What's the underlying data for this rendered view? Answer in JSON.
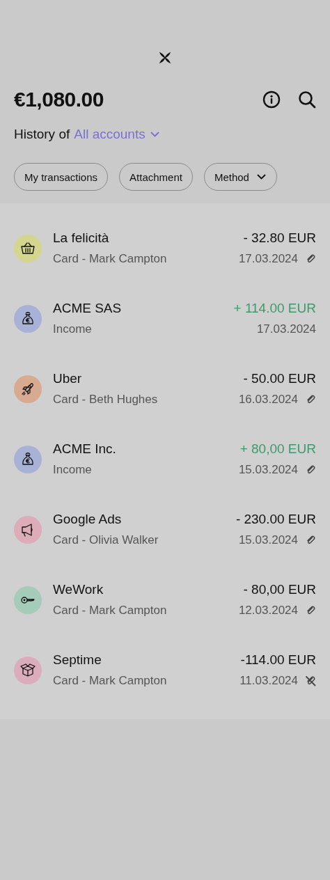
{
  "balance": "€1,080.00",
  "history": {
    "label": "History of",
    "account": "All accounts"
  },
  "filters": [
    {
      "label": "My transactions",
      "dropdown": false
    },
    {
      "label": "Attachment",
      "dropdown": false
    },
    {
      "label": "Method",
      "dropdown": true
    }
  ],
  "transactions": [
    {
      "name": "La felicità",
      "detail": "Card - Mark Campton",
      "amount": "- 32.80 EUR",
      "date": "17.03.2024",
      "credit": false,
      "clip": true,
      "attached": true,
      "kind": "basket",
      "color": "#d5d68e"
    },
    {
      "name": "ACME SAS",
      "detail": "Income",
      "amount": "+ 114.00 EUR",
      "date": "17.03.2024",
      "credit": true,
      "clip": false,
      "kind": "moneybag",
      "color": "#a8b2d6"
    },
    {
      "name": "Uber",
      "detail": "Card - Beth Hughes",
      "amount": "- 50.00 EUR",
      "date": "16.03.2024",
      "credit": false,
      "clip": true,
      "attached": true,
      "kind": "rocket",
      "color": "#d8aa90"
    },
    {
      "name": "ACME Inc.",
      "detail": "Income",
      "amount": "+ 80,00 EUR",
      "date": "15.03.2024",
      "credit": true,
      "clip": true,
      "attached": true,
      "kind": "moneybag",
      "color": "#a8b2d6"
    },
    {
      "name": "Google Ads",
      "detail": "Card - Olivia Walker",
      "amount": "- 230.00 EUR",
      "date": "15.03.2024",
      "credit": false,
      "clip": true,
      "attached": true,
      "kind": "megaphone",
      "color": "#dcacb8"
    },
    {
      "name": "WeWork",
      "detail": "Card - Mark Campton",
      "amount": "- 80,00 EUR",
      "date": "12.03.2024",
      "credit": false,
      "clip": true,
      "attached": true,
      "kind": "key",
      "color": "#a4ccb8"
    },
    {
      "name": "Septime",
      "detail": "Card - Mark Campton",
      "amount": "-114.00 EUR",
      "date": "11.03.2024",
      "credit": false,
      "clip": true,
      "attached": false,
      "kind": "box",
      "color": "#dbacbc"
    }
  ]
}
